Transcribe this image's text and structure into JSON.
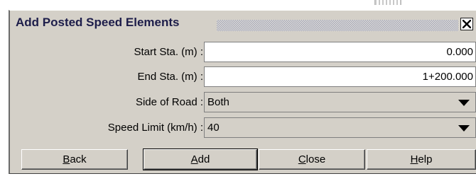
{
  "dialog": {
    "title": "Add Posted Speed Elements"
  },
  "fields": [
    {
      "label": "Start Sta. (m) :",
      "value": "0.000"
    },
    {
      "label": "End Sta. (m) :",
      "value": "1+200.000"
    }
  ],
  "selects": [
    {
      "label": "Side of Road :",
      "value": "Both"
    },
    {
      "label": "Speed Limit (km/h) :",
      "value": "40"
    }
  ],
  "buttons": {
    "back": {
      "mnemonic": "B",
      "rest": "ack"
    },
    "add": {
      "mnemonic": "A",
      "rest": "dd"
    },
    "close": {
      "mnemonic": "C",
      "rest": "lose"
    },
    "help": {
      "mnemonic": "H",
      "rest": "elp"
    }
  },
  "icons": {
    "close": "close-icon",
    "dropdown": "chevron-down-icon"
  },
  "colors": {
    "dialog_bg": "#d4d0c8",
    "title_text": "#1d1d4a"
  }
}
